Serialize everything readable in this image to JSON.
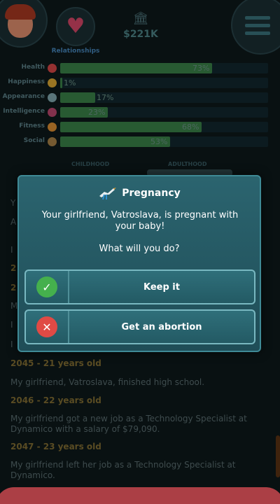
{
  "header": {
    "relationships_label": "Relationships",
    "money": "$221K",
    "avatar_icon": "avatar-face",
    "relationships_icon": "heart-icon",
    "bank_icon": "bank-icon",
    "menu_icon": "menu-icon"
  },
  "stats": [
    {
      "label": "Health",
      "value": "73%",
      "fraction": 0.73,
      "color": "#2f6a3b",
      "icon_color": "#b03a3a",
      "icon": "heart-icon"
    },
    {
      "label": "Happiness",
      "value": "1%",
      "fraction": 0.01,
      "color": "#2f6a3b",
      "icon_color": "#b58a2a",
      "icon": "smile-icon"
    },
    {
      "label": "Appearance",
      "value": "17%",
      "fraction": 0.17,
      "color": "#2f6a3b",
      "icon_color": "#6a8a90",
      "icon": "eye-icon"
    },
    {
      "label": "Intelligence",
      "value": "23%",
      "fraction": 0.23,
      "color": "#2f6a3b",
      "icon_color": "#9a3a5a",
      "icon": "brain-icon"
    },
    {
      "label": "Fitness",
      "value": "68%",
      "fraction": 0.68,
      "color": "#2f6a3b",
      "icon_color": "#b5752a",
      "icon": "muscle-icon"
    },
    {
      "label": "Social",
      "value": "53%",
      "fraction": 0.53,
      "color": "#2f6a3b",
      "icon_color": "#8a6a3a",
      "icon": "social-icon"
    }
  ],
  "tabs": {
    "childhood": "CHILDHOOD",
    "adulthood": "ADULTHOOD"
  },
  "feed": {
    "entries": [
      {
        "year": "2045 - 21 years old",
        "text": "My girlfriend, Vatroslava, finished high school."
      },
      {
        "year": "2046 - 22 years old",
        "text": "My girlfriend got a new job as a Technology Specialist at Dynamico with a salary of $79,090."
      },
      {
        "year": "2047 - 23 years old",
        "text": "My girlfriend left her job as a Technology Specialist at Dynamico."
      }
    ]
  },
  "modal": {
    "title": "Pregnancy",
    "title_icon": "stork-icon",
    "message": "Your girlfriend, Vatroslava, is pregnant with your baby!",
    "question": "What will you do?",
    "choices": [
      {
        "label": "Keep it",
        "icon": "check-icon",
        "glyph": "✓"
      },
      {
        "label": "Get an abortion",
        "icon": "close-icon",
        "glyph": "✕"
      }
    ]
  },
  "colors": {
    "modal_bg": "#2b646f",
    "accept": "#45b04d",
    "decline": "#e04a45",
    "bottom_bar": "#c94b52"
  }
}
